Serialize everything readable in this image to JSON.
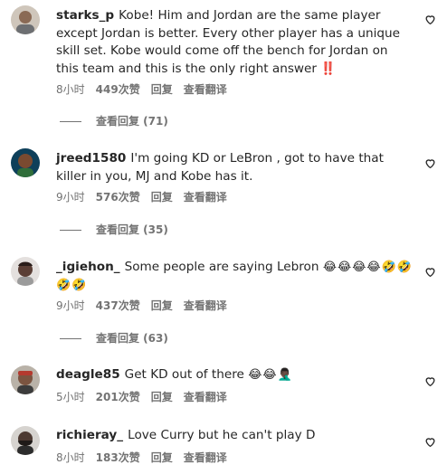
{
  "comments": [
    {
      "username": "starks_p",
      "text": "Kobe! Him and Jordan are the same player except Jordan is better. Every other player has a unique skill set. Kobe would come off the bench for Jordan on this team and this is the only right answer ‼️",
      "time": "8小时",
      "likes": "449次赞",
      "reply": "回复",
      "translate": "查看翻译",
      "view_replies": "查看回复 (71)"
    },
    {
      "username": "jreed1580",
      "text": "I'm going KD or LeBron , got to have that killer in you, MJ and Kobe has it.",
      "time": "9小时",
      "likes": "576次赞",
      "reply": "回复",
      "translate": "查看翻译",
      "view_replies": "查看回复 (35)"
    },
    {
      "username": "_igiehon_",
      "text": "Some people are saying Lebron",
      "emojis": "😂😂😂😂🤣🤣🤣🤣",
      "time": "9小时",
      "likes": "437次赞",
      "reply": "回复",
      "translate": "查看翻译",
      "view_replies": "查看回复 (63)"
    },
    {
      "username": "deagle85",
      "text": "Get KD out of there",
      "emojis": "😂😂🤦🏿‍♂️",
      "time": "5小时",
      "likes": "201次赞",
      "reply": "回复",
      "translate": "查看翻译"
    },
    {
      "username": "richieray_",
      "text": "Love Curry but he can't play D",
      "time": "8小时",
      "likes": "183次赞",
      "reply": "回复",
      "translate": "查看翻译"
    }
  ],
  "icons": {
    "like": "heart-outline-icon"
  },
  "colors": {
    "text": "#262626",
    "secondary": "#737373"
  }
}
